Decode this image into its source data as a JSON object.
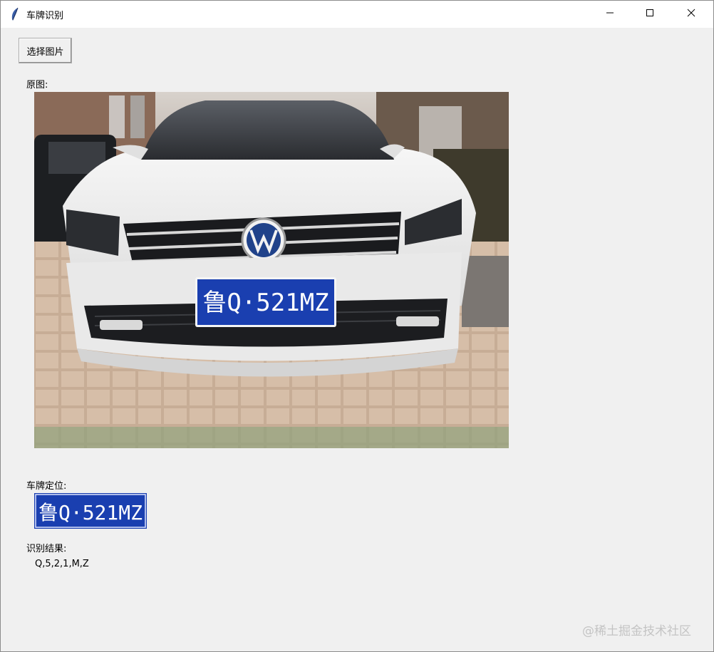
{
  "window": {
    "title": "车牌识别",
    "icons": {
      "app": "feather-icon",
      "minimize": "minimize-icon",
      "maximize": "maximize-icon",
      "close": "close-icon"
    }
  },
  "toolbar": {
    "select_image_label": "选择图片"
  },
  "sections": {
    "original_label": "原图:",
    "plate_locate_label": "车牌定位:",
    "result_label": "识别结果:"
  },
  "photo": {
    "plate_text": "鲁Q·521MZ"
  },
  "plate_crop": {
    "plate_text": "鲁Q·521MZ"
  },
  "result": {
    "value": "Q,5,2,1,M,Z"
  },
  "watermark": {
    "text": "@稀土掘金技术社区"
  },
  "colors": {
    "window_bg": "#f0f0f0",
    "titlebar_bg": "#ffffff",
    "plate_blue": "#1a3fb0",
    "plate_text": "#ffffff",
    "car_white": "#ededed",
    "pavement": "#c2a88f"
  }
}
